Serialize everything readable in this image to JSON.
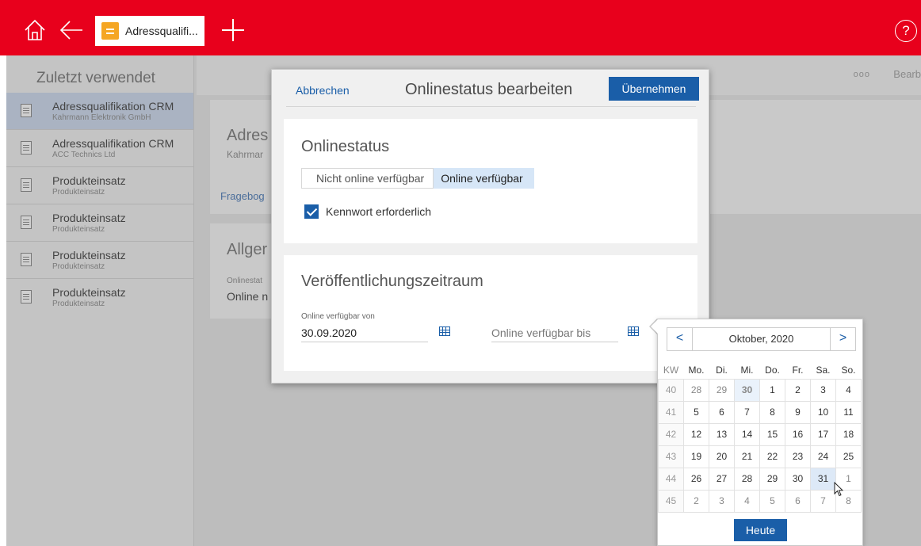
{
  "titlebar": {
    "tab_label": "Adressqualifi...",
    "help_symbol": "?",
    "accent_color": "#e8001c"
  },
  "sidebar": {
    "title": "Zuletzt verwendet",
    "items": [
      {
        "title": "Adressqualifikation CRM",
        "subtitle": "Kahrmann Elektronik GmbH"
      },
      {
        "title": "Adressqualifikation CRM",
        "subtitle": "ACC Technics Ltd"
      },
      {
        "title": "Produkteinsatz",
        "subtitle": "Produkteinsatz"
      },
      {
        "title": "Produkteinsatz",
        "subtitle": "Produkteinsatz"
      },
      {
        "title": "Produkteinsatz",
        "subtitle": "Produkteinsatz"
      },
      {
        "title": "Produkteinsatz",
        "subtitle": "Produkteinsatz"
      }
    ]
  },
  "main": {
    "more_dots": "ooo",
    "action_partial": "Bearb",
    "card1_heading": "Adres",
    "card1_sub": "Kahrmar",
    "card1_link": "Fragebog",
    "card2_heading": "Allger",
    "card2_label": "Onlinestat",
    "card2_value": "Online n"
  },
  "dialog": {
    "cancel_label": "Abbrechen",
    "title": "Onlinestatus bearbeiten",
    "ok_label": "Übernehmen",
    "section1_title": "Onlinestatus",
    "segment_off": "Nicht online verfügbar",
    "segment_on": "Online verfügbar",
    "checkbox_label": "Kennwort erforderlich",
    "section2_title": "Veröffentlichungszeitraum",
    "from_label": "Online verfügbar von",
    "from_value": "30.09.2020",
    "to_placeholder": "Online verfügbar bis"
  },
  "calendar": {
    "month_label": "Oktober, 2020",
    "prev_symbol": "<",
    "next_symbol": ">",
    "kw_label": "KW",
    "weekdays": [
      "Mo.",
      "Di.",
      "Mi.",
      "Do.",
      "Fr.",
      "Sa.",
      "So."
    ],
    "weeks": [
      {
        "kw": "40",
        "days": [
          "28",
          "29",
          "30",
          "1",
          "2",
          "3",
          "4"
        ]
      },
      {
        "kw": "41",
        "days": [
          "5",
          "6",
          "7",
          "8",
          "9",
          "10",
          "11"
        ]
      },
      {
        "kw": "42",
        "days": [
          "12",
          "13",
          "14",
          "15",
          "16",
          "17",
          "18"
        ]
      },
      {
        "kw": "43",
        "days": [
          "19",
          "20",
          "21",
          "22",
          "23",
          "24",
          "25"
        ]
      },
      {
        "kw": "44",
        "days": [
          "26",
          "27",
          "28",
          "29",
          "30",
          "31",
          "1"
        ]
      },
      {
        "kw": "45",
        "days": [
          "2",
          "3",
          "4",
          "5",
          "6",
          "7",
          "8"
        ]
      }
    ],
    "today_label": "Heute"
  }
}
